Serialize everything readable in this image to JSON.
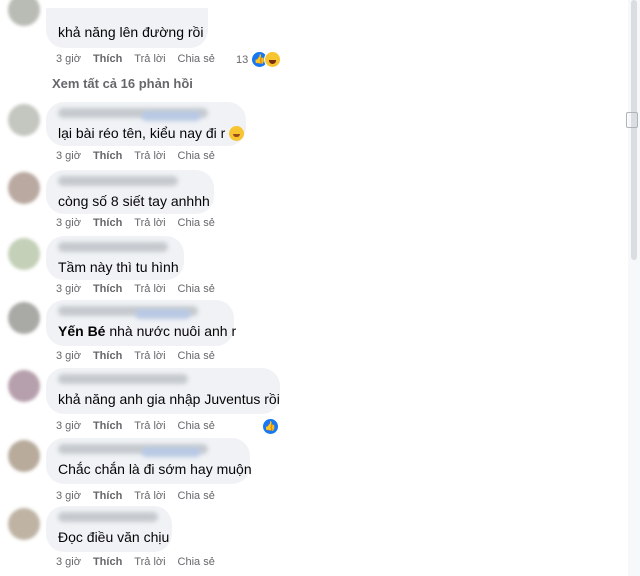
{
  "actions": {
    "like": "Thích",
    "reply": "Trả lời",
    "share": "Chia sẻ"
  },
  "view_all_replies": "Xem tất cả 16 phản hồi",
  "comments": [
    {
      "text": "khả năng lên đường rồi",
      "time": "3 giờ",
      "reactions": {
        "count": "13",
        "icons": [
          "like-icon",
          "haha-icon"
        ]
      }
    },
    {
      "text": "lại bài réo tên, kiểu nay đi r",
      "time": "3 giờ",
      "emoji": "grinning-emoji"
    },
    {
      "text": "còng số 8 siết tay anhhh",
      "time": "3 giờ"
    },
    {
      "text": "Tầm này thì tu hình",
      "time": "3 giờ"
    },
    {
      "mention": "Yến Bé",
      "text": " nhà nước nuôi anh r",
      "time": "3 giờ"
    },
    {
      "text": "khả năng anh gia nhập Juventus rồi",
      "time": "3 giờ",
      "reactions": {
        "icons": [
          "like-icon"
        ]
      }
    },
    {
      "text": "Chắc chắn là đi sớm hay muộn",
      "time": "3 giờ"
    },
    {
      "text": "Đọc điều văn chịu",
      "time": "3 giờ"
    }
  ],
  "colors": {
    "bubble": "#f0f2f5",
    "meta": "#65676b",
    "like_blue": "#1877f2"
  }
}
